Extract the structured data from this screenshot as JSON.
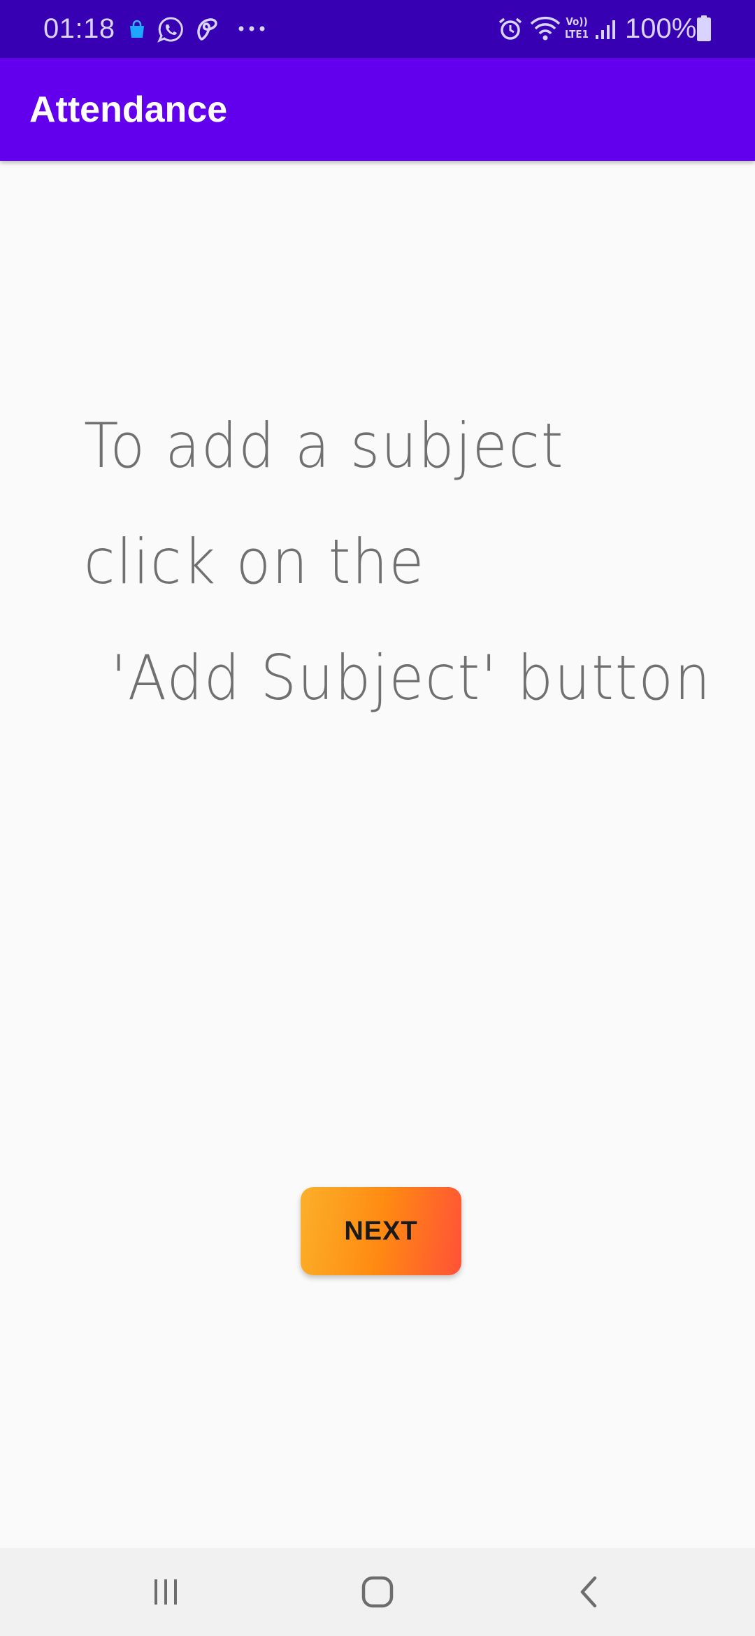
{
  "status_bar": {
    "time": "01:18",
    "battery_percent": "100%",
    "icons": [
      "shopping-bag-icon",
      "whatsapp-icon",
      "airtel-icon",
      "more-notifications-icon",
      "alarm-icon",
      "wifi-icon",
      "volte-lte-icon",
      "signal-icon",
      "battery-icon"
    ],
    "volte_text": "Vo))",
    "lte_text": "LTE1"
  },
  "app_bar": {
    "title": "Attendance"
  },
  "instruction": {
    "line1": "To add a subject",
    "line2": "click on the",
    "line3": "'Add Subject' button"
  },
  "actions": {
    "next_label": "NEXT"
  },
  "nav_bar": {
    "icons": [
      "recent-apps-icon",
      "home-icon",
      "back-icon"
    ]
  },
  "colors": {
    "status_bar": "#3700b3",
    "app_bar": "#6200ee",
    "background": "#fafafa",
    "button_gradient_start": "#fbb02a",
    "button_gradient_end": "#ff5137",
    "instruction_text": "#707070",
    "nav_bar": "#f1f1f1"
  }
}
